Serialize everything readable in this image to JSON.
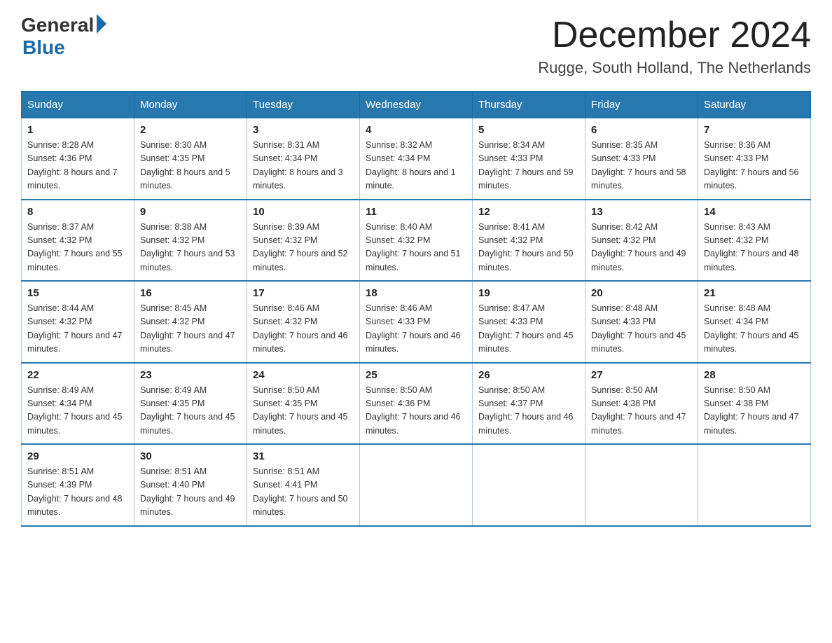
{
  "header": {
    "logo_general": "General",
    "logo_blue": "Blue",
    "title": "December 2024",
    "location": "Rugge, South Holland, The Netherlands"
  },
  "days_of_week": [
    "Sunday",
    "Monday",
    "Tuesday",
    "Wednesday",
    "Thursday",
    "Friday",
    "Saturday"
  ],
  "weeks": [
    [
      {
        "day": "1",
        "sunrise": "8:28 AM",
        "sunset": "4:36 PM",
        "daylight": "8 hours and 7 minutes."
      },
      {
        "day": "2",
        "sunrise": "8:30 AM",
        "sunset": "4:35 PM",
        "daylight": "8 hours and 5 minutes."
      },
      {
        "day": "3",
        "sunrise": "8:31 AM",
        "sunset": "4:34 PM",
        "daylight": "8 hours and 3 minutes."
      },
      {
        "day": "4",
        "sunrise": "8:32 AM",
        "sunset": "4:34 PM",
        "daylight": "8 hours and 1 minute."
      },
      {
        "day": "5",
        "sunrise": "8:34 AM",
        "sunset": "4:33 PM",
        "daylight": "7 hours and 59 minutes."
      },
      {
        "day": "6",
        "sunrise": "8:35 AM",
        "sunset": "4:33 PM",
        "daylight": "7 hours and 58 minutes."
      },
      {
        "day": "7",
        "sunrise": "8:36 AM",
        "sunset": "4:33 PM",
        "daylight": "7 hours and 56 minutes."
      }
    ],
    [
      {
        "day": "8",
        "sunrise": "8:37 AM",
        "sunset": "4:32 PM",
        "daylight": "7 hours and 55 minutes."
      },
      {
        "day": "9",
        "sunrise": "8:38 AM",
        "sunset": "4:32 PM",
        "daylight": "7 hours and 53 minutes."
      },
      {
        "day": "10",
        "sunrise": "8:39 AM",
        "sunset": "4:32 PM",
        "daylight": "7 hours and 52 minutes."
      },
      {
        "day": "11",
        "sunrise": "8:40 AM",
        "sunset": "4:32 PM",
        "daylight": "7 hours and 51 minutes."
      },
      {
        "day": "12",
        "sunrise": "8:41 AM",
        "sunset": "4:32 PM",
        "daylight": "7 hours and 50 minutes."
      },
      {
        "day": "13",
        "sunrise": "8:42 AM",
        "sunset": "4:32 PM",
        "daylight": "7 hours and 49 minutes."
      },
      {
        "day": "14",
        "sunrise": "8:43 AM",
        "sunset": "4:32 PM",
        "daylight": "7 hours and 48 minutes."
      }
    ],
    [
      {
        "day": "15",
        "sunrise": "8:44 AM",
        "sunset": "4:32 PM",
        "daylight": "7 hours and 47 minutes."
      },
      {
        "day": "16",
        "sunrise": "8:45 AM",
        "sunset": "4:32 PM",
        "daylight": "7 hours and 47 minutes."
      },
      {
        "day": "17",
        "sunrise": "8:46 AM",
        "sunset": "4:32 PM",
        "daylight": "7 hours and 46 minutes."
      },
      {
        "day": "18",
        "sunrise": "8:46 AM",
        "sunset": "4:33 PM",
        "daylight": "7 hours and 46 minutes."
      },
      {
        "day": "19",
        "sunrise": "8:47 AM",
        "sunset": "4:33 PM",
        "daylight": "7 hours and 45 minutes."
      },
      {
        "day": "20",
        "sunrise": "8:48 AM",
        "sunset": "4:33 PM",
        "daylight": "7 hours and 45 minutes."
      },
      {
        "day": "21",
        "sunrise": "8:48 AM",
        "sunset": "4:34 PM",
        "daylight": "7 hours and 45 minutes."
      }
    ],
    [
      {
        "day": "22",
        "sunrise": "8:49 AM",
        "sunset": "4:34 PM",
        "daylight": "7 hours and 45 minutes."
      },
      {
        "day": "23",
        "sunrise": "8:49 AM",
        "sunset": "4:35 PM",
        "daylight": "7 hours and 45 minutes."
      },
      {
        "day": "24",
        "sunrise": "8:50 AM",
        "sunset": "4:35 PM",
        "daylight": "7 hours and 45 minutes."
      },
      {
        "day": "25",
        "sunrise": "8:50 AM",
        "sunset": "4:36 PM",
        "daylight": "7 hours and 46 minutes."
      },
      {
        "day": "26",
        "sunrise": "8:50 AM",
        "sunset": "4:37 PM",
        "daylight": "7 hours and 46 minutes."
      },
      {
        "day": "27",
        "sunrise": "8:50 AM",
        "sunset": "4:38 PM",
        "daylight": "7 hours and 47 minutes."
      },
      {
        "day": "28",
        "sunrise": "8:50 AM",
        "sunset": "4:38 PM",
        "daylight": "7 hours and 47 minutes."
      }
    ],
    [
      {
        "day": "29",
        "sunrise": "8:51 AM",
        "sunset": "4:39 PM",
        "daylight": "7 hours and 48 minutes."
      },
      {
        "day": "30",
        "sunrise": "8:51 AM",
        "sunset": "4:40 PM",
        "daylight": "7 hours and 49 minutes."
      },
      {
        "day": "31",
        "sunrise": "8:51 AM",
        "sunset": "4:41 PM",
        "daylight": "7 hours and 50 minutes."
      },
      null,
      null,
      null,
      null
    ]
  ]
}
